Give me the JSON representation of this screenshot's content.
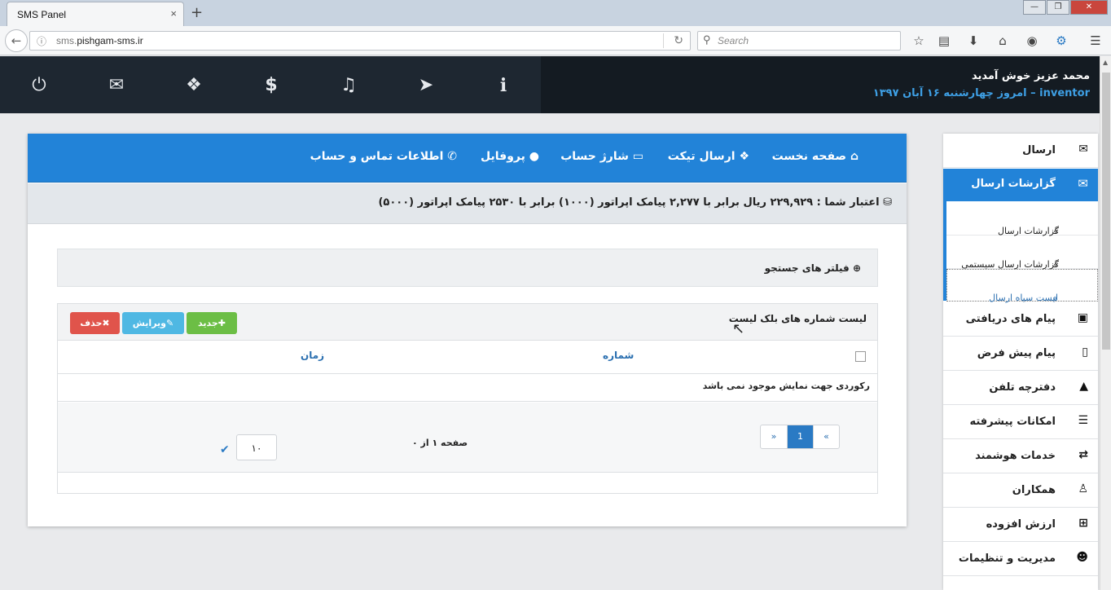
{
  "browser": {
    "tab_title": "SMS Panel",
    "tab_close": "×",
    "new_tab": "+",
    "url_prefix": "sms.",
    "url_domain": "pishgam-sms.ir",
    "search_placeholder": "Search",
    "win_min": "—",
    "win_max": "❐",
    "win_close": "✕"
  },
  "header": {
    "welcome": "محمد عزیز خوش آمدید",
    "username": "inventor",
    "date_text": "– امروز چهارشنبه ۱۶ آبان ۱۳۹۷",
    "icons": [
      "power-icon",
      "envelope-icon",
      "ticket-icon",
      "dollar-icon",
      "bell-icon",
      "paper-plane-icon",
      "info-icon"
    ]
  },
  "topnav": {
    "home": "صفحه نخست",
    "ticket": "ارسال تیکت",
    "charge": "شارژ حساب",
    "profile": "پروفایل",
    "contact": "اطلاعات تماس و حساب"
  },
  "credit": {
    "text": "اعتبار شما : ۲۲۹,۹۲۹ ریال برابر با ۲,۲۷۷ پیامک اپراتور (۱۰۰۰) برابر با ۲۵۳۰ پیامک اپراتور (۵۰۰۰)"
  },
  "filter": {
    "label": "فیلتر های جستجو"
  },
  "list": {
    "title": "لیست شماره های بلک لیست",
    "btn_new": "جدید",
    "btn_edit": "ویرایش",
    "btn_delete": "حذف",
    "col_number": "شماره",
    "col_time": "زمان",
    "empty": "رکوردی جهت نمایش موجود نمی باشد",
    "pager_prev": "«",
    "pager_page": "1",
    "pager_next": "»",
    "page_info": "صفحه ۱ از ۰",
    "page_size": "۱۰"
  },
  "sidebar": {
    "send": "ارسال",
    "reports": "گزارشات ارسال",
    "sub_reports": "گزارشات ارسال",
    "sub_system": "گزارشات ارسال سیستمی",
    "sub_blacklist": "لیست سیاه ارسال",
    "received": "پیام های دریافتی",
    "default_msg": "پیام پیش فرض",
    "phonebook": "دفترچه تلفن",
    "advanced": "امکانات پیشرفته",
    "smart": "خدمات هوشمند",
    "partners": "همکاران",
    "value_added": "ارزش افزوده",
    "settings": "مدیریت و تنظیمات"
  },
  "colors": {
    "primary": "#2283d8",
    "header_dark": "#1e2731",
    "danger": "#e0544b",
    "info": "#4fb8e3",
    "success": "#6cbe45"
  }
}
